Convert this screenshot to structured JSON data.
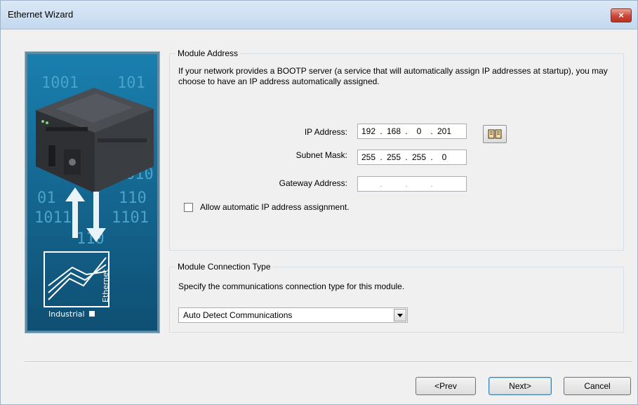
{
  "window": {
    "title": "Ethernet Wizard",
    "close_label": "×"
  },
  "side_image": {
    "binary_text": [
      "1001",
      "101",
      "010",
      "01",
      "110",
      "1011",
      "1101",
      "110"
    ],
    "logo_text": "Industrial",
    "logo_vertical_text": "Ethernet"
  },
  "module_address": {
    "legend": "Module Address",
    "description": "If your network provides a BOOTP server (a service that will automatically assign IP addresses at startup), you may choose to have an IP address automatically assigned.",
    "ip": {
      "label": "IP Address:",
      "octets": [
        "192",
        "168",
        "0",
        "201"
      ]
    },
    "subnet": {
      "label": "Subnet Mask:",
      "octets": [
        "255",
        "255",
        "255",
        "0"
      ]
    },
    "gateway": {
      "label": "Gateway Address:",
      "octets": [
        "",
        "",
        "",
        ""
      ]
    },
    "book_icon": "address-book-icon",
    "auto_assign_label": "Allow automatic IP address assignment.",
    "auto_assign_checked": false
  },
  "connection": {
    "legend": "Module Connection Type",
    "description": "Specify the communications connection type for this module.",
    "selected": "Auto Detect Communications"
  },
  "buttons": {
    "prev": "<Prev",
    "next": "Next>",
    "cancel": "Cancel"
  },
  "colors": {
    "accent": "#3c7fb1",
    "close": "#c8463a",
    "side_panel": "#1d6d93"
  }
}
